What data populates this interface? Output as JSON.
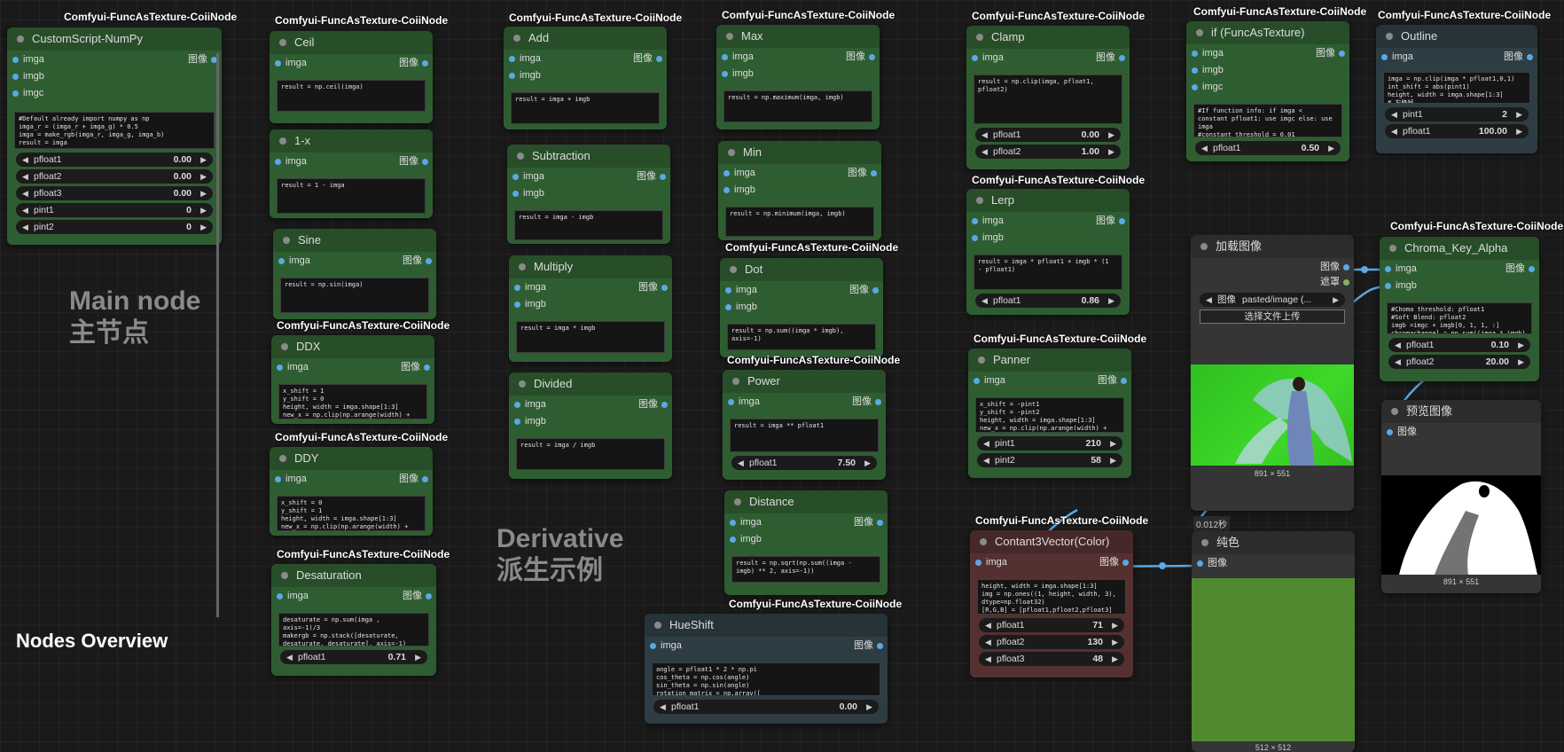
{
  "colors": {
    "canvas": "#1a1a1a",
    "node_green": "#2f5d32",
    "node_gray": "#353535",
    "node_slate": "#2e3d44",
    "node_red": "#553030",
    "wire_blue": "#5aa9e6"
  },
  "icons": {
    "input_pin": "input-slot-dot",
    "output_pin": "output-slot-dot",
    "arrow_left": "◀",
    "arrow_right": "▶",
    "collapse": "node-collapse-dot"
  },
  "overlay": {
    "main_line1": "Main node",
    "main_line2": "主节点",
    "deriv_line1": "Derivative",
    "deriv_line2": "派生示例",
    "overview": "Nodes Overview"
  },
  "labels": {
    "badge": "Comfyui-FuncAsTexture-CoiiNode",
    "image_out": "图像"
  },
  "nodes": {
    "customscript": {
      "title": "CustomScript-NumPy",
      "inputs": [
        "imga",
        "imgb",
        "imgc"
      ],
      "code": "#Default already import numpy as np\nimga_r = (imga_r + imga_g) * 0.5\nimga = make_rgb(imga_r, imga_g, imga_b)\nresult = imga",
      "params": [
        {
          "name": "pfloat1",
          "value": "0.00"
        },
        {
          "name": "pfloat2",
          "value": "0.00"
        },
        {
          "name": "pfloat3",
          "value": "0.00"
        },
        {
          "name": "pint1",
          "value": "0"
        },
        {
          "name": "pint2",
          "value": "0"
        }
      ]
    },
    "ceil": {
      "title": "Ceil",
      "inputs": [
        "imga"
      ],
      "code": "result = np.ceil(imga)"
    },
    "oneminus": {
      "title": "1-x",
      "inputs": [
        "imga"
      ],
      "code": "result = 1 - imga"
    },
    "sine": {
      "title": "Sine",
      "inputs": [
        "imga"
      ],
      "code": "result = np.sin(imga)"
    },
    "ddx": {
      "title": "DDX",
      "inputs": [
        "imga"
      ],
      "code": "x_shift = 1\ny_shift = 0\nheight, width = imga.shape[1:3]\nnew_x = np.clip(np.arange(width) +"
    },
    "ddy": {
      "title": "DDY",
      "inputs": [
        "imga"
      ],
      "code": "x_shift = 0\ny_shift = 1\nheight, width = imga.shape[1:3]\nnew_x = np.clip(np.arange(width) +"
    },
    "desaturation": {
      "title": "Desaturation",
      "inputs": [
        "imga"
      ],
      "code": "desaturate = np.sum(imga ,\naxis=-1)/3\nmakergb = np.stack([desaturate,\ndesaturate, desaturate], axis=-1)",
      "params": [
        {
          "name": "pfloat1",
          "value": "0.71"
        }
      ]
    },
    "add": {
      "title": "Add",
      "inputs": [
        "imga",
        "imgb"
      ],
      "code": "result = imga + imgb"
    },
    "subtraction": {
      "title": "Subtraction",
      "inputs": [
        "imga",
        "imgb"
      ],
      "code": "result = imga - imgb"
    },
    "multiply": {
      "title": "Multiply",
      "inputs": [
        "imga",
        "imgb"
      ],
      "code": "result = imga * imgb"
    },
    "divided": {
      "title": "Divided",
      "inputs": [
        "imga",
        "imgb"
      ],
      "code": "result = imga / imgb"
    },
    "max": {
      "title": "Max",
      "inputs": [
        "imga",
        "imgb"
      ],
      "code": "result = np.maximum(imga, imgb)"
    },
    "min": {
      "title": "Min",
      "inputs": [
        "imga",
        "imgb"
      ],
      "code": "result = np.minimum(imga, imgb)"
    },
    "dot": {
      "title": "Dot",
      "inputs": [
        "imga",
        "imgb"
      ],
      "code": "result = np.sum((imga * imgb),\naxis=-1)"
    },
    "power": {
      "title": "Power",
      "inputs": [
        "imga"
      ],
      "code": "result = imga ** pfloat1",
      "params": [
        {
          "name": "pfloat1",
          "value": "7.50"
        }
      ]
    },
    "distance": {
      "title": "Distance",
      "inputs": [
        "imga",
        "imgb"
      ],
      "code": "result = np.sqrt(np.sum((imga -\nimgb) ** 2, axis=-1))"
    },
    "hueshift": {
      "title": "HueShift",
      "inputs": [
        "imga"
      ],
      "code": "angle = pfloat1 * 2 * np.pi\ncos_theta = np.cos(angle)\nsin_theta = np.sin(angle)\nrotation_matrix = np.array([",
      "params": [
        {
          "name": "pfloat1",
          "value": "0.00"
        }
      ]
    },
    "clamp": {
      "title": "Clamp",
      "inputs": [
        "imga"
      ],
      "code": "result = np.clip(imga, pfloat1,\npfloat2)",
      "params": [
        {
          "name": "pfloat1",
          "value": "0.00"
        },
        {
          "name": "pfloat2",
          "value": "1.00"
        }
      ]
    },
    "lerp": {
      "title": "Lerp",
      "inputs": [
        "imga",
        "imgb"
      ],
      "code": "result = imga * pfloat1 + imgb * (1\n- pfloat1)",
      "params": [
        {
          "name": "pfloat1",
          "value": "0.86"
        }
      ]
    },
    "panner": {
      "title": "Panner",
      "inputs": [
        "imga"
      ],
      "code": "x_shift = -pint1\ny_shift = -pint2\nheight, width = imga.shape[1:3]\nnew_x = np.clip(np.arange(width) +",
      "params": [
        {
          "name": "pint1",
          "value": "210"
        },
        {
          "name": "pint2",
          "value": "58"
        }
      ]
    },
    "constant": {
      "title": "Contant3Vector(Color)",
      "inputs": [
        "imga"
      ],
      "code": "height, width = imga.shape[1:3]\nimg = np.ones((1, height, width, 3),\ndtype=np.float32)\n[R,G,B] = [pfloat1,pfloat2,pfloat3]",
      "params": [
        {
          "name": "pfloat1",
          "value": "71"
        },
        {
          "name": "pfloat2",
          "value": "130"
        },
        {
          "name": "pfloat3",
          "value": "48"
        }
      ]
    },
    "iffunc": {
      "title": "if (FuncAsTexture)",
      "inputs": [
        "imga",
        "imgb",
        "imgc"
      ],
      "code": "#If function info: if imga <\nconstant pfloat1: use imgc else: use\nimga\n#constant threshold = 0.01",
      "params": [
        {
          "name": "pfloat1",
          "value": "0.50"
        }
      ]
    },
    "outline": {
      "title": "Outline",
      "inputs": [
        "imga"
      ],
      "code": "imga = np.clip(imga * pfloat1,0,1)\nint_shift = abs(pint1)\nheight, width = imga.shape[1:3]\n# 左移帧",
      "params": [
        {
          "name": "pint1",
          "value": "2"
        },
        {
          "name": "pfloat1",
          "value": "100.00"
        }
      ]
    },
    "loadimage": {
      "title": "加载图像",
      "out1": "图像",
      "out2": "遮罩",
      "combo_label": "图像",
      "combo_value": "pasted/image (...",
      "upload": "选择文件上传",
      "dims": "891 × 551"
    },
    "chroma": {
      "title": "Chroma_Key_Alpha",
      "inputs": [
        "imga",
        "imgb"
      ],
      "code": "#Choma threshold: pfloat1\n#Soft Blend: pfloat2\nimgb =imgc + imgb[0, 1, 1, :]\nchromachannel = np.sum((imga * imgb)",
      "params": [
        {
          "name": "pfloat1",
          "value": "0.10"
        },
        {
          "name": "pfloat2",
          "value": "20.00"
        }
      ]
    },
    "preview": {
      "title": "预览图像",
      "input": "图像",
      "dims": "891 × 551"
    },
    "solid": {
      "title": "纯色",
      "input": "图像",
      "dims": "512 × 512",
      "timing": "0.012秒",
      "color": "#4f8a2f"
    }
  }
}
